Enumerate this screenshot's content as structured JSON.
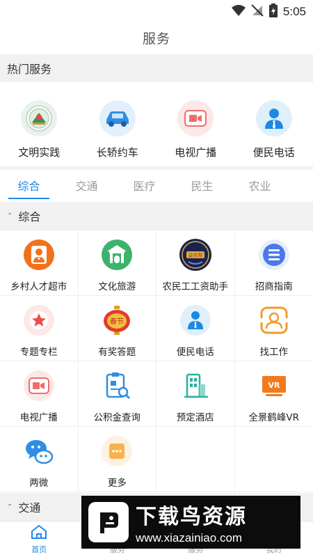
{
  "status_bar": {
    "time": "5:05"
  },
  "header": {
    "title": "服务"
  },
  "hot_services": {
    "title": "热门服务",
    "items": [
      {
        "label": "文明实践",
        "icon": "emblem-icon"
      },
      {
        "label": "长轿约车",
        "icon": "car-icon"
      },
      {
        "label": "电视广播",
        "icon": "video-icon"
      },
      {
        "label": "便民电话",
        "icon": "person-tie-icon"
      }
    ]
  },
  "tabs": [
    {
      "label": "综合",
      "active": true
    },
    {
      "label": "交通",
      "active": false
    },
    {
      "label": "医疗",
      "active": false
    },
    {
      "label": "民生",
      "active": false
    },
    {
      "label": "农业",
      "active": false
    }
  ],
  "category": {
    "title": "综合",
    "items": [
      {
        "label": "乡村人才超市",
        "icon": "talent-icon"
      },
      {
        "label": "文化旅游",
        "icon": "pavilion-icon"
      },
      {
        "label": "农民工工资助手",
        "icon": "wage-badge-icon"
      },
      {
        "label": "招商指南",
        "icon": "list-icon"
      },
      {
        "label": "专题专栏",
        "icon": "star-icon"
      },
      {
        "label": "有奖答题",
        "icon": "lantern-icon"
      },
      {
        "label": "便民电话",
        "icon": "person-tie-icon"
      },
      {
        "label": "找工作",
        "icon": "job-search-icon"
      },
      {
        "label": "电视广播",
        "icon": "video-icon"
      },
      {
        "label": "公积金查询",
        "icon": "document-search-icon"
      },
      {
        "label": "预定酒店",
        "icon": "hotel-icon"
      },
      {
        "label": "全景鹤峰VR",
        "icon": "vr-icon"
      },
      {
        "label": "两微",
        "icon": "weibo-wechat-icon"
      },
      {
        "label": "更多",
        "icon": "more-icon"
      }
    ],
    "badge_text": {
      "wage": "益农帮",
      "lantern": "春节",
      "vr": "VR"
    }
  },
  "traffic_section": {
    "title": "交通"
  },
  "bottom_nav": [
    {
      "label": "首页",
      "active": true
    },
    {
      "label": "服务",
      "active": false
    },
    {
      "label": "服务",
      "active": false
    },
    {
      "label": "我的",
      "active": false
    }
  ],
  "watermark": {
    "title": "下载鸟资源",
    "url": "www.xiazainiao.com"
  },
  "colors": {
    "accent": "#1e88e5",
    "section_bg": "#f1f1f1",
    "green": "#2e9b4a",
    "orange": "#f2711c"
  }
}
